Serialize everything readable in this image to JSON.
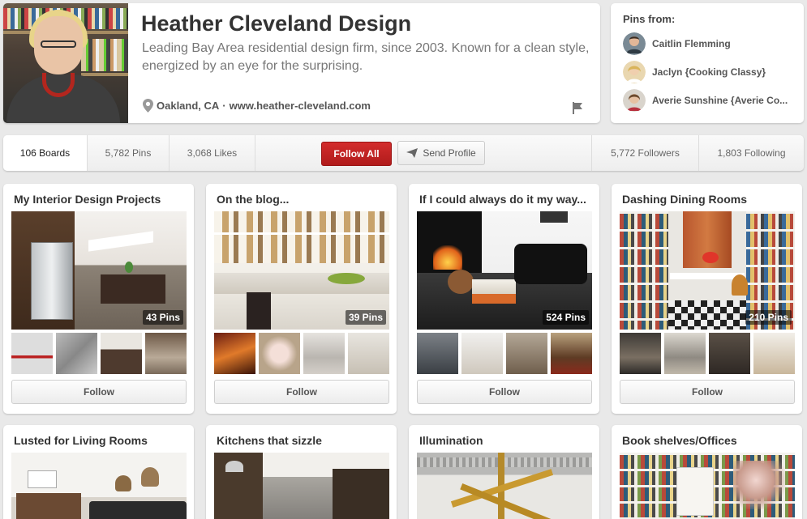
{
  "profile": {
    "name": "Heather Cleveland Design",
    "description": "Leading Bay Area residential design firm, since 2003. Known for a clean style, energized by an eye for the surprising.",
    "location": "Oakland, CA",
    "separator": "·",
    "website": "www.heather-cleveland.com"
  },
  "pins_from": {
    "title": "Pins from:",
    "sources": [
      {
        "name": "Caitlin Flemming"
      },
      {
        "name": "Jaclyn {Cooking Classy}"
      },
      {
        "name": "Averie Sunshine {Averie Co..."
      }
    ]
  },
  "stats": {
    "boards": "106 Boards",
    "pins": "5,782 Pins",
    "likes": "3,068 Likes",
    "followers": "5,772 Followers",
    "following": "1,803 Following"
  },
  "actions": {
    "follow_all": "Follow All",
    "send_profile": "Send Profile"
  },
  "boards": [
    {
      "title": "My Interior Design Projects",
      "pin_count": "43 Pins",
      "follow": "Follow"
    },
    {
      "title": "On the blog...",
      "pin_count": "39 Pins",
      "follow": "Follow"
    },
    {
      "title": "If I could always do it my way...",
      "pin_count": "524 Pins",
      "follow": "Follow"
    },
    {
      "title": "Dashing Dining Rooms",
      "pin_count": "210 Pins",
      "follow": "Follow"
    },
    {
      "title": "Lusted for Living Rooms"
    },
    {
      "title": "Kitchens that sizzle"
    },
    {
      "title": "Illumination"
    },
    {
      "title": "Book shelves/Offices"
    }
  ],
  "colors": {
    "accent_red": "#c62323",
    "background": "#e9e9e9"
  }
}
